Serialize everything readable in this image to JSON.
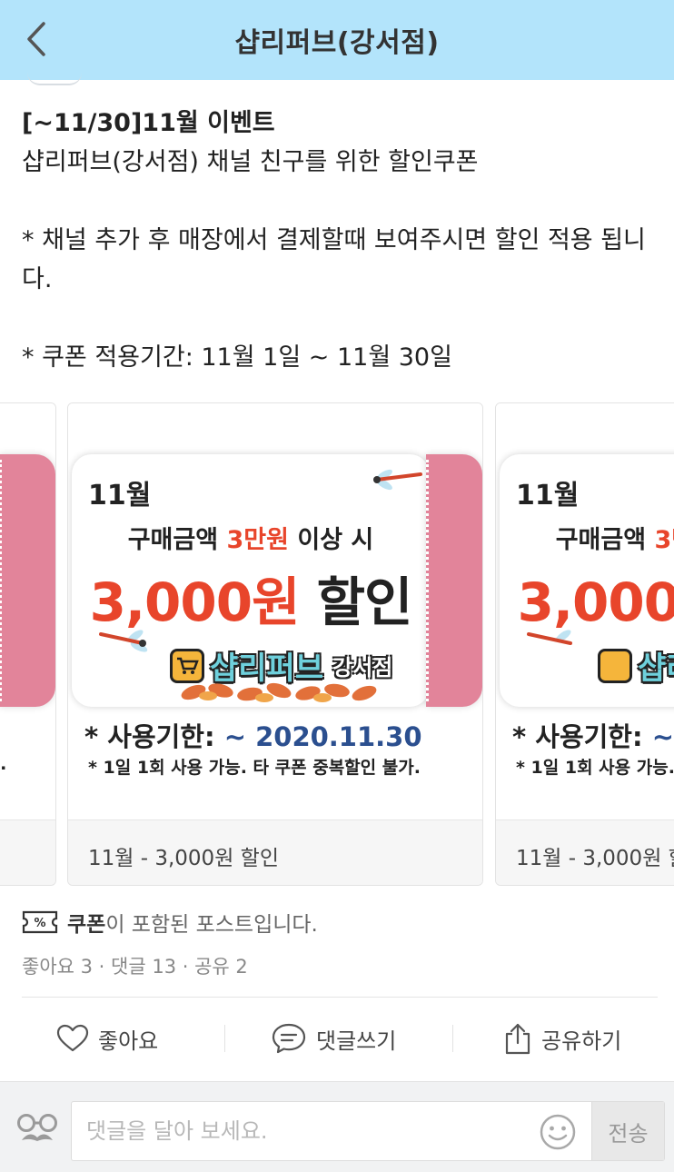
{
  "header": {
    "title": "샵리퍼브(강서점)"
  },
  "post": {
    "title": "[~11/30]11월 이벤트",
    "line1": "샵리퍼브(강서점) 채널 친구를 위한 할인쿠폰",
    "line2": "* 채널 추가 후 매장에서 결제할때 보여주시면 할인 적용 됩니다.",
    "line3": "* 쿠폰 적용기간: 11월 1일 ~ 11월 30일"
  },
  "coupon": {
    "month": "11월",
    "line1_prefix": "구매금액 ",
    "line1_highlight": "3만원",
    "line1_suffix": " 이상 시",
    "amount": "3,000원",
    "discount": " 할인",
    "brand": "샵리퍼브",
    "branch": "강서점",
    "expiry_label": "* 사용기한: ",
    "expiry_date": "~ 2020.11.30",
    "usage_note": "* 1일 1회 사용 가능. 타 쿠폰 중복할인 불가.",
    "caption": "11월 - 3,000원 할인",
    "prev_note_tail": "t."
  },
  "coupon_notice": {
    "bold": "쿠폰",
    "rest": "이 포함된 포스트입니다."
  },
  "stats": "좋아요 3 · 댓글 13 · 공유 2",
  "actions": {
    "like": "좋아요",
    "comment": "댓글쓰기",
    "share": "공유하기"
  },
  "comment_input": {
    "placeholder": "댓글을 달아 보세요.",
    "send": "전송"
  },
  "colors": {
    "header_bg": "#b3e4fb",
    "coupon_red": "#e8452b",
    "stub_pink": "#e2849a",
    "expiry_blue": "#2b4f8f"
  }
}
